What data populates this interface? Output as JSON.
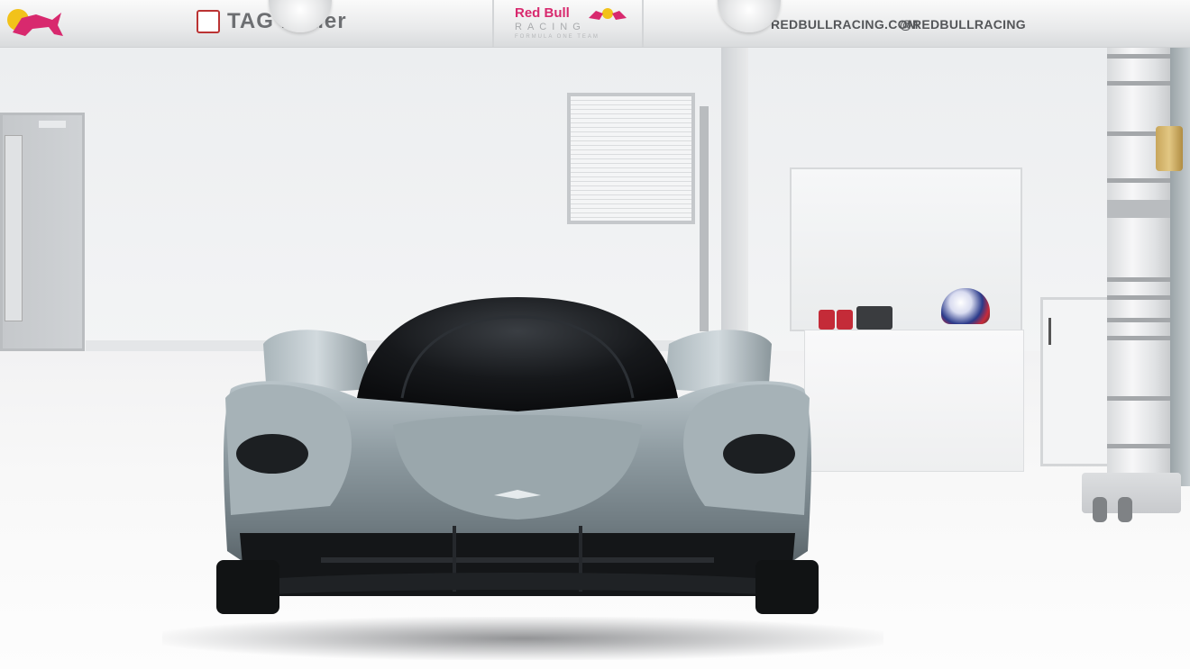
{
  "signage": {
    "tag_heuer": "TAG Heuer",
    "red_bull": "Red Bull",
    "racing": "RACING",
    "formula_one_team": "FORMULA ONE TEAM",
    "website": "REDBULLRACING.COM",
    "handle": "@REDBULLRACING"
  },
  "colors": {
    "car_body": "#8d9aa0",
    "cockpit": "#16181b",
    "redbull_red": "#d8296e",
    "redbull_yellow": "#f2c21a"
  }
}
